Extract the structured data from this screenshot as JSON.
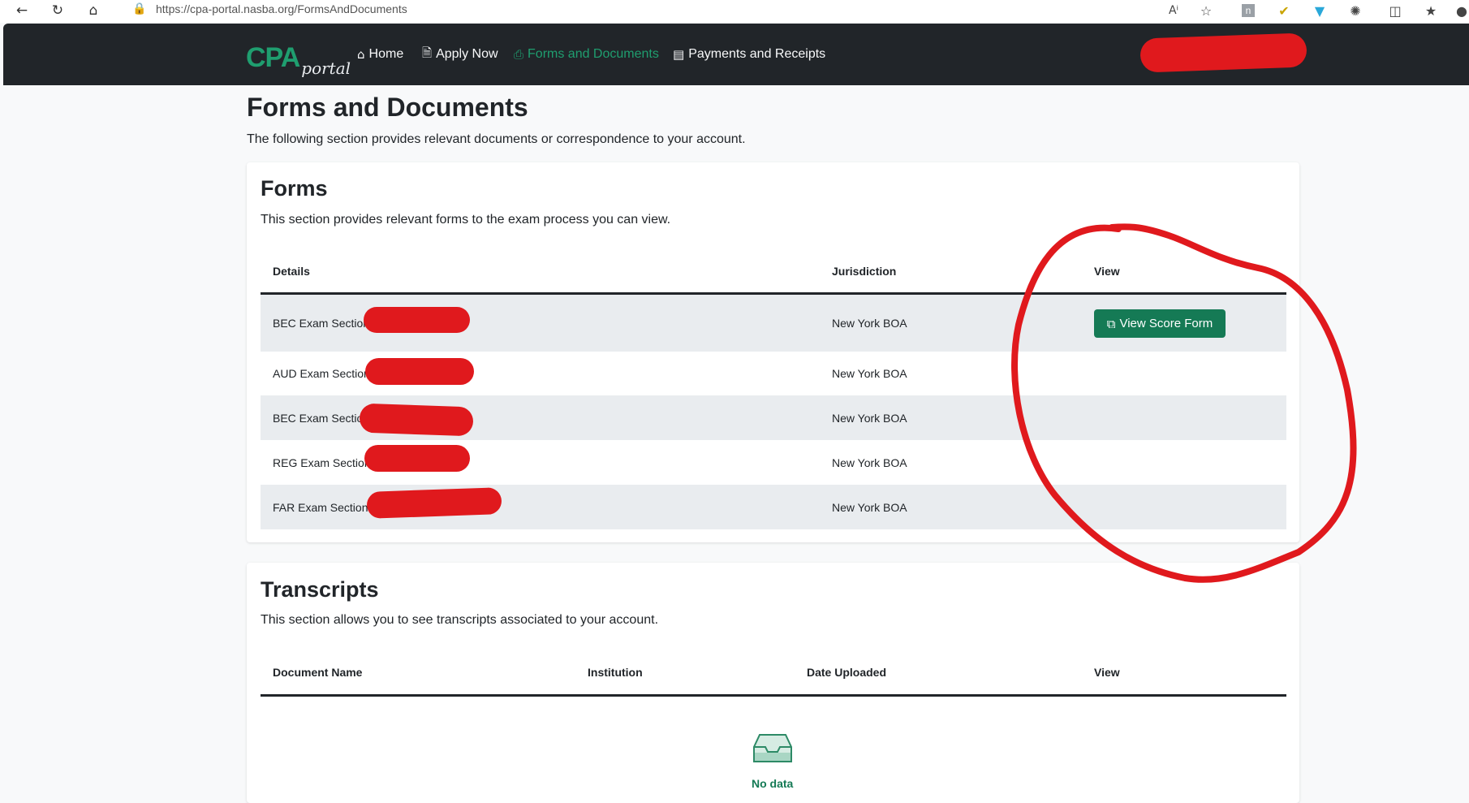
{
  "browser": {
    "url": "https://cpa-portal.nasba.org/FormsAndDocuments",
    "icons": [
      "back-arrow-icon",
      "refresh-icon",
      "home-icon",
      "lock-icon",
      "read-aloud-icon",
      "favorite-star-icon",
      "extension-n-icon",
      "extension-check-icon",
      "extension-shield-icon",
      "extensions-puzzle-icon",
      "split-screen-icon",
      "favorites-list-icon"
    ]
  },
  "nav": {
    "logo_cpa": "CPA",
    "logo_portal": "portal",
    "items": [
      {
        "label": "Home",
        "icon": "house-icon",
        "active": false
      },
      {
        "label": "Apply Now",
        "icon": "file-plus-icon",
        "active": false
      },
      {
        "label": "Forms and Documents",
        "icon": "printer-icon",
        "active": true
      },
      {
        "label": "Payments and Receipts",
        "icon": "credit-card-icon",
        "active": false
      }
    ],
    "accent_color": "#1f9e6f"
  },
  "page": {
    "title": "Forms and Documents",
    "subtitle": "The following section provides relevant documents or correspondence to your account."
  },
  "forms": {
    "title": "Forms",
    "subtitle": "This section provides relevant forms to the exam process you can view.",
    "columns": [
      "Details",
      "Jurisdiction",
      "View"
    ],
    "rows": [
      {
        "details": "BEC Exam Section",
        "jurisdiction": "New York BOA",
        "view": "View Score Form"
      },
      {
        "details": "AUD Exam Section",
        "jurisdiction": "New York BOA",
        "view": ""
      },
      {
        "details": "BEC Exam Section",
        "jurisdiction": "New York BOA",
        "view": ""
      },
      {
        "details": "REG Exam Section",
        "jurisdiction": "New York BOA",
        "view": ""
      },
      {
        "details": "FAR Exam Section",
        "jurisdiction": "New York BOA",
        "view": ""
      }
    ]
  },
  "transcripts": {
    "title": "Transcripts",
    "subtitle": "This section allows you to see transcripts associated to your account.",
    "columns": [
      "Document Name",
      "Institution",
      "Date Uploaded",
      "View"
    ],
    "empty_text": "No data",
    "empty_icon": "empty-inbox-icon"
  },
  "colors": {
    "navbar": "#212529",
    "button": "#157a55",
    "stripe": "#e9ecef",
    "redaction": "#e0191d"
  }
}
